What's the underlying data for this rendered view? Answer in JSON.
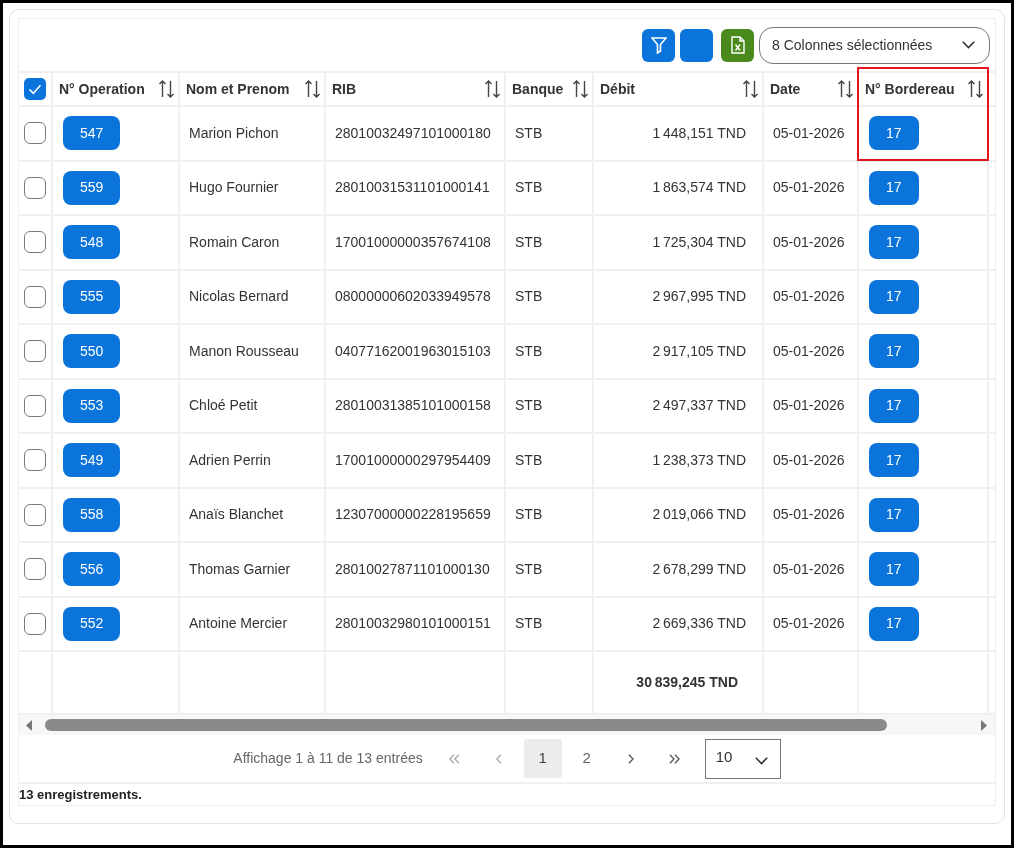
{
  "toolbar": {
    "buttons": [
      {
        "kind": "filter"
      },
      {
        "kind": "blank"
      },
      {
        "kind": "excel"
      }
    ],
    "columns_select": "8 Colonnes sélectionnées"
  },
  "table": {
    "select_all": {
      "checked": true
    },
    "columns": [
      {
        "label": "N° Operation",
        "kind": "button",
        "highlighted": false
      },
      {
        "label": "Nom et Prenom",
        "kind": "text",
        "highlighted": false
      },
      {
        "label": "RIB",
        "kind": "text",
        "highlighted": false
      },
      {
        "label": "Banque",
        "kind": "text",
        "highlighted": false
      },
      {
        "label": "Débit",
        "kind": "amount",
        "highlighted": false
      },
      {
        "label": "Date",
        "kind": "text",
        "highlighted": false
      },
      {
        "label": "N° Bordereau",
        "kind": "button",
        "highlighted": true
      }
    ],
    "rows": [
      {
        "checked": false,
        "cells": [
          "547",
          "Marion Pichon",
          "28010032497101000180",
          "STB",
          "1 448,151 TND",
          "05-01-2026",
          "17"
        ]
      },
      {
        "checked": false,
        "cells": [
          "559",
          "Hugo Fournier",
          "28010031531101000141",
          "STB",
          "1 863,574 TND",
          "05-01-2026",
          "17"
        ]
      },
      {
        "checked": false,
        "cells": [
          "548",
          "Romain Caron",
          "17001000000357674108",
          "STB",
          "1 725,304 TND",
          "05-01-2026",
          "17"
        ]
      },
      {
        "checked": false,
        "cells": [
          "555",
          "Nicolas Bernard",
          "08000000602033949578",
          "STB",
          "2 967,995 TND",
          "05-01-2026",
          "17"
        ]
      },
      {
        "checked": false,
        "cells": [
          "550",
          "Manon Rousseau",
          "04077162001963015103",
          "STB",
          "2 917,105 TND",
          "05-01-2026",
          "17"
        ]
      },
      {
        "checked": false,
        "cells": [
          "553",
          "Chloé Petit",
          "28010031385101000158",
          "STB",
          "2 497,337 TND",
          "05-01-2026",
          "17"
        ]
      },
      {
        "checked": false,
        "cells": [
          "549",
          "Adrien Perrin",
          "17001000000297954409",
          "STB",
          "1 238,373 TND",
          "05-01-2026",
          "17"
        ]
      },
      {
        "checked": false,
        "cells": [
          "558",
          "Anaïs Blanchet",
          "12307000000228195659",
          "STB",
          "2 019,066 TND",
          "05-01-2026",
          "17"
        ]
      },
      {
        "checked": false,
        "cells": [
          "556",
          "Thomas Garnier",
          "28010027871101000130",
          "STB",
          "2 678,299 TND",
          "05-01-2026",
          "17"
        ]
      },
      {
        "checked": false,
        "cells": [
          "552",
          "Antoine Mercier",
          "28010032980101000151",
          "STB",
          "2 669,336 TND",
          "05-01-2026",
          "17"
        ]
      }
    ],
    "total": {
      "debit": "30 839,245 TND"
    }
  },
  "pager": {
    "summary": "Affichage 1 à 11 de 13 entrées",
    "first": {
      "disabled": true
    },
    "previous": {
      "disabled": true
    },
    "pages": [
      {
        "label": "1",
        "selected": true
      },
      {
        "label": "2",
        "selected": false
      }
    ],
    "next": {
      "disabled": false
    },
    "last": {
      "disabled": false
    },
    "page_size": "10"
  },
  "status": "13 enregistrements."
}
